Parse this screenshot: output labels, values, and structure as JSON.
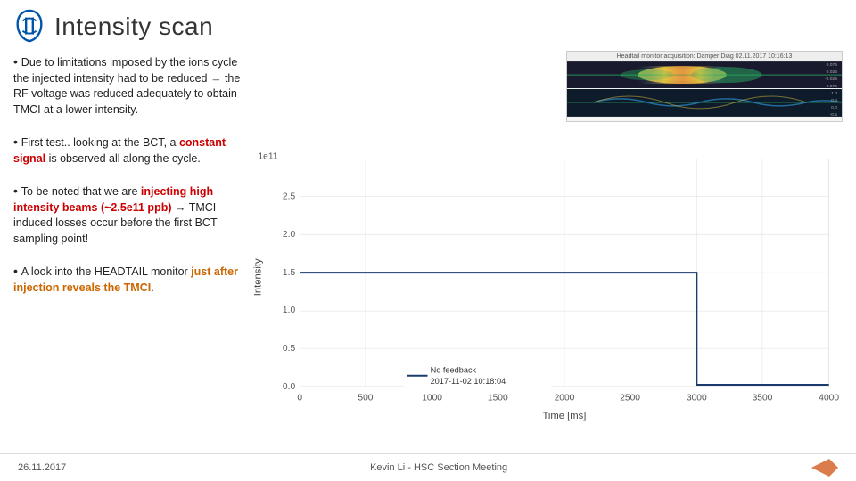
{
  "header": {
    "title": "Intensity scan",
    "logo_alt": "CERN logo"
  },
  "bullets": [
    {
      "id": "bullet1",
      "text_parts": [
        {
          "text": "Due to limitations imposed by the ions cycle the injected intensity had to be reduced → the RF voltage was reduced adequately to obtain TMCI at a lower intensity.",
          "style": "normal"
        }
      ]
    },
    {
      "id": "bullet2",
      "text_parts": [
        {
          "text": "First test.. looking at the BCT, a ",
          "style": "normal"
        },
        {
          "text": "constant signal",
          "style": "red"
        },
        {
          "text": " is observed all along the cycle.",
          "style": "normal"
        }
      ]
    },
    {
      "id": "bullet3",
      "text_parts": [
        {
          "text": "To be noted that we are ",
          "style": "normal"
        },
        {
          "text": "injecting high intensity beams (~2.5e11 ppb)",
          "style": "red"
        },
        {
          "text": " → TMCI induced losses occur before the first BCT sampling point!",
          "style": "normal"
        }
      ]
    },
    {
      "id": "bullet4",
      "text_parts": [
        {
          "text": "A look into the HEADTAIL monitor ",
          "style": "normal"
        },
        {
          "text": "just after injection reveals the TMCI",
          "style": "orange"
        },
        {
          "text": ".",
          "style": "normal"
        }
      ]
    }
  ],
  "chart": {
    "y_label": "Intensity",
    "x_label": "Time [ms]",
    "y_axis_unit": "1e11",
    "y_ticks": [
      "0.0",
      "0.5",
      "1.0",
      "1.5",
      "2.0",
      "2.5"
    ],
    "x_ticks": [
      "0",
      "500",
      "1000",
      "1500",
      "2000",
      "2500",
      "3000",
      "3500",
      "4000"
    ],
    "legend": {
      "label": "No feedback",
      "timestamp": "2017-11-02 10:18:04",
      "color": "#1a5276"
    },
    "top_chart_title": "Headtail monitor acquisition: Damper Diag 02.11.2017 10:16:13"
  },
  "footer": {
    "date": "26.11.2017",
    "presenter": "Kevin Li - HSC Section Meeting"
  }
}
